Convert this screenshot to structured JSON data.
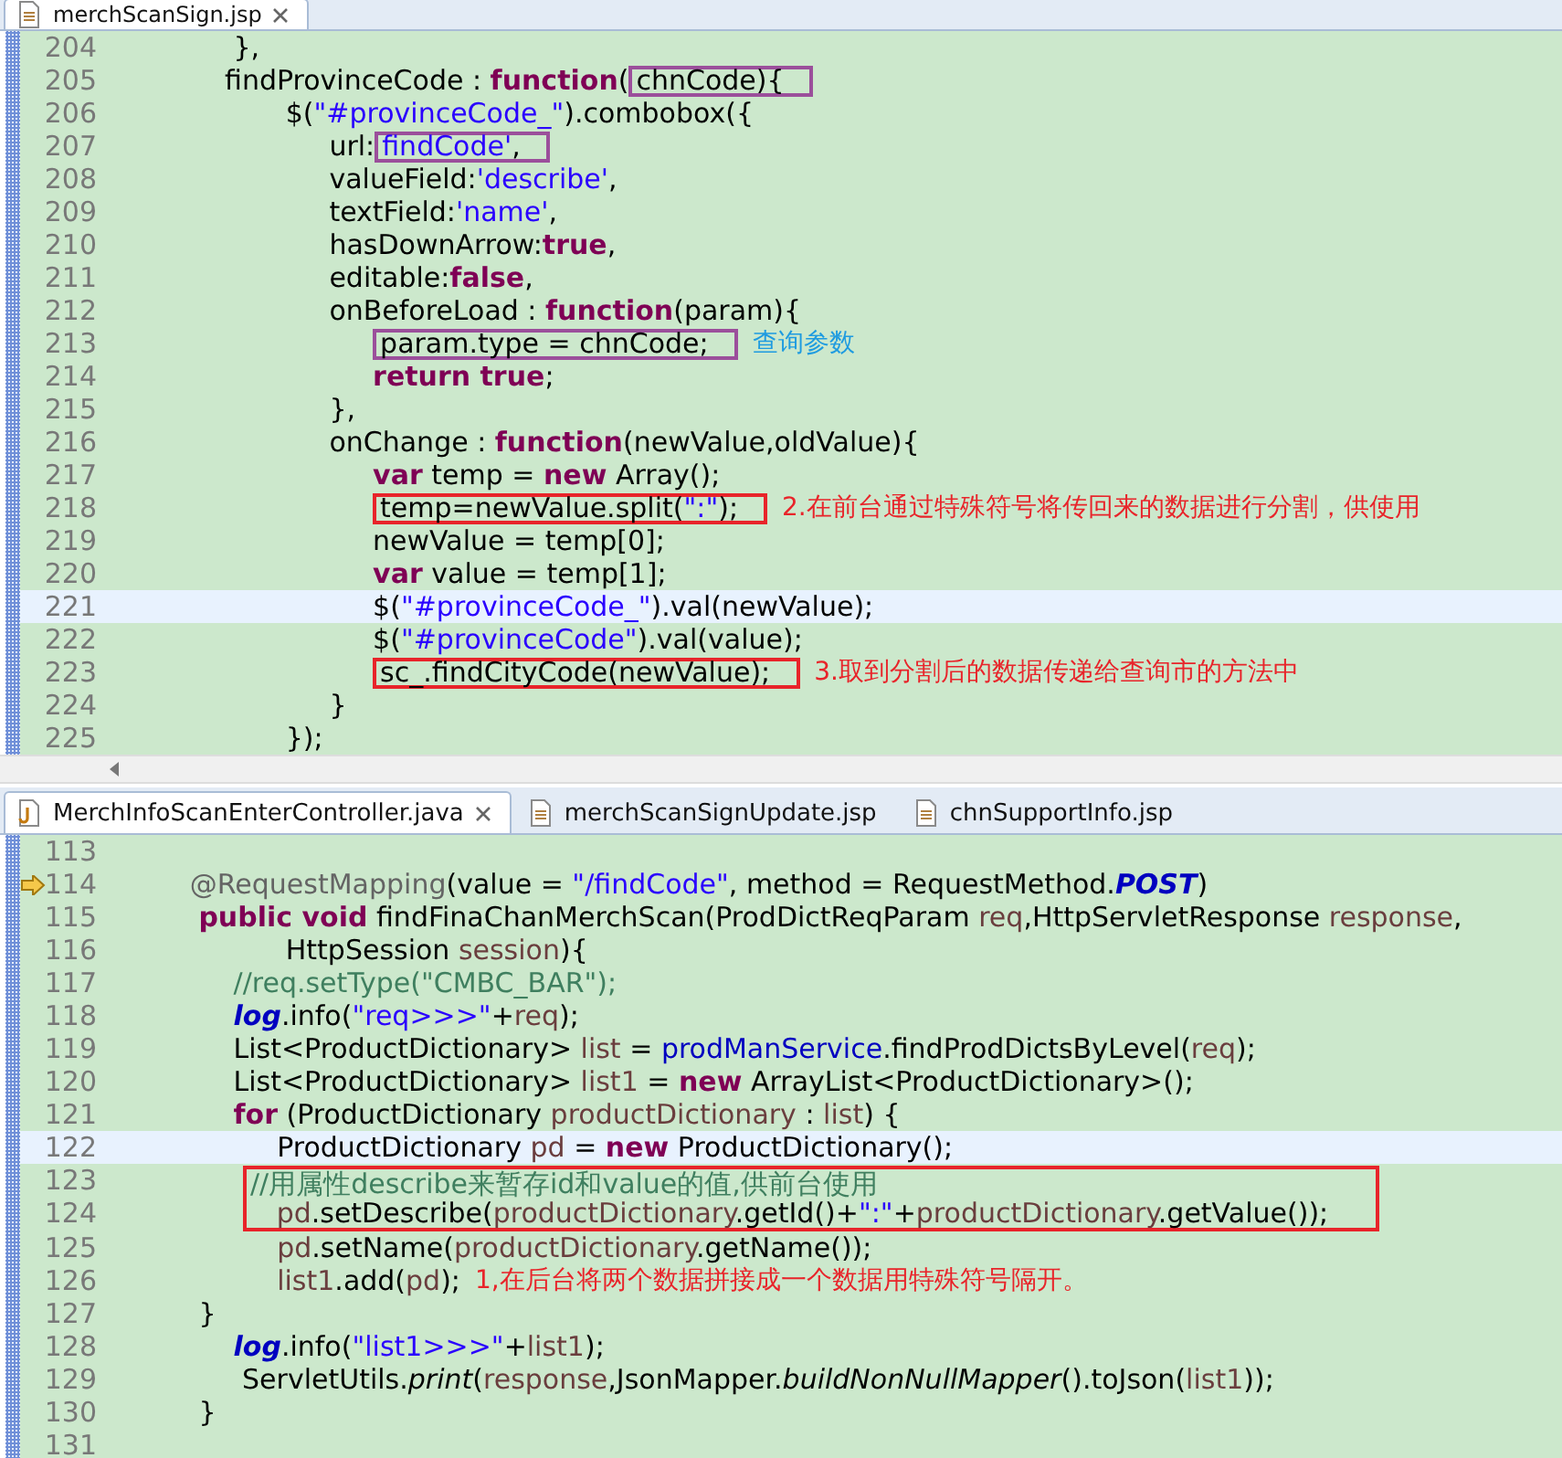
{
  "top_editor": {
    "tabs": [
      {
        "label": "merchScanSign.jsp",
        "selected": true,
        "closable": true
      }
    ],
    "lines": [
      {
        "kind": "line",
        "number": "204",
        "current": false,
        "tokens": [
          {
            "kind": "plain",
            "text": "              },"
          }
        ]
      },
      {
        "kind": "line",
        "number": "205",
        "current": false,
        "box": {
          "color": "#9b4f9b"
        },
        "tokens": [
          {
            "kind": "plain",
            "text": "             findProvinceCode : "
          },
          {
            "kind": "keyword",
            "text": "function"
          },
          {
            "kind": "plain",
            "text": "("
          },
          {
            "kind": "plain",
            "text": "chnCode){",
            "boxed": true
          }
        ]
      },
      {
        "kind": "line",
        "number": "206",
        "current": false,
        "tokens": [
          {
            "kind": "plain",
            "text": "                    $("
          },
          {
            "kind": "string",
            "text": "\"#provinceCode_\""
          },
          {
            "kind": "plain",
            "text": ").combobox({"
          }
        ]
      },
      {
        "kind": "line",
        "number": "207",
        "current": false,
        "box": {
          "color": "#9b4f9b"
        },
        "tokens": [
          {
            "kind": "plain",
            "text": "                         url:"
          },
          {
            "kind": "string",
            "text": "findCode'",
            "boxed": true
          },
          {
            "kind": "plain",
            "text": ",",
            "boxed": true
          }
        ]
      },
      {
        "kind": "line",
        "number": "208",
        "current": false,
        "tokens": [
          {
            "kind": "plain",
            "text": "                         valueField:"
          },
          {
            "kind": "string",
            "text": "'describe'"
          },
          {
            "kind": "plain",
            "text": ","
          }
        ]
      },
      {
        "kind": "line",
        "number": "209",
        "current": false,
        "tokens": [
          {
            "kind": "plain",
            "text": "                         textField:"
          },
          {
            "kind": "string",
            "text": "'name'"
          },
          {
            "kind": "plain",
            "text": ","
          }
        ]
      },
      {
        "kind": "line",
        "number": "210",
        "current": false,
        "tokens": [
          {
            "kind": "plain",
            "text": "                         hasDownArrow:"
          },
          {
            "kind": "keyword",
            "text": "true"
          },
          {
            "kind": "plain",
            "text": ","
          }
        ]
      },
      {
        "kind": "line",
        "number": "211",
        "current": false,
        "tokens": [
          {
            "kind": "plain",
            "text": "                         editable:"
          },
          {
            "kind": "keyword",
            "text": "false"
          },
          {
            "kind": "plain",
            "text": ","
          }
        ]
      },
      {
        "kind": "line",
        "number": "212",
        "current": false,
        "tokens": [
          {
            "kind": "plain",
            "text": "                         onBeforeLoad : "
          },
          {
            "kind": "keyword",
            "text": "function"
          },
          {
            "kind": "plain",
            "text": "(param){"
          }
        ]
      },
      {
        "kind": "line",
        "number": "213",
        "current": false,
        "box": {
          "color": "#9b4f9b"
        },
        "note": {
          "text": "查询参数",
          "color": "#1e9be0"
        },
        "tokens": [
          {
            "kind": "plain",
            "text": "                              param.type = chnCode;",
            "boxed": true
          }
        ]
      },
      {
        "kind": "line",
        "number": "214",
        "current": false,
        "tokens": [
          {
            "kind": "keyword",
            "text": "                              return true"
          },
          {
            "kind": "plain",
            "text": ";"
          }
        ]
      },
      {
        "kind": "line",
        "number": "215",
        "current": false,
        "tokens": [
          {
            "kind": "plain",
            "text": "                         },"
          }
        ]
      },
      {
        "kind": "line",
        "number": "216",
        "current": false,
        "tokens": [
          {
            "kind": "plain",
            "text": "                         onChange : "
          },
          {
            "kind": "keyword",
            "text": "function"
          },
          {
            "kind": "plain",
            "text": "(newValue,oldValue){"
          }
        ]
      },
      {
        "kind": "line",
        "number": "217",
        "current": false,
        "tokens": [
          {
            "kind": "keyword",
            "text": "                              var"
          },
          {
            "kind": "plain",
            "text": " temp = "
          },
          {
            "kind": "keyword",
            "text": "new"
          },
          {
            "kind": "plain",
            "text": " Array();"
          }
        ]
      },
      {
        "kind": "line",
        "number": "218",
        "current": false,
        "box": {
          "color": "#e8242a"
        },
        "note": {
          "text": "2.在前台通过特殊符号将传回来的数据进行分割，供使用",
          "color": "#e8242a"
        },
        "tokens": [
          {
            "kind": "plain",
            "text": "                              temp=newValue.split(",
            "boxed": true
          },
          {
            "kind": "string",
            "text": "\":\"",
            "boxed": true
          },
          {
            "kind": "plain",
            "text": ");",
            "boxed": true
          }
        ]
      },
      {
        "kind": "line",
        "number": "219",
        "current": false,
        "tokens": [
          {
            "kind": "plain",
            "text": "                              newValue = temp[0];"
          }
        ]
      },
      {
        "kind": "line",
        "number": "220",
        "current": false,
        "tokens": [
          {
            "kind": "keyword",
            "text": "                              var"
          },
          {
            "kind": "plain",
            "text": " value = temp[1];"
          }
        ]
      },
      {
        "kind": "line",
        "number": "221",
        "current": true,
        "tokens": [
          {
            "kind": "plain",
            "text": "                              $("
          },
          {
            "kind": "string",
            "text": "\"#provinceCode_\""
          },
          {
            "kind": "plain",
            "text": ").val(newValue);"
          }
        ]
      },
      {
        "kind": "line",
        "number": "222",
        "current": false,
        "tokens": [
          {
            "kind": "plain",
            "text": "                              $("
          },
          {
            "kind": "string",
            "text": "\"#provinceCode\""
          },
          {
            "kind": "plain",
            "text": ").val(value);"
          }
        ]
      },
      {
        "kind": "line",
        "number": "223",
        "current": false,
        "box": {
          "color": "#e8242a"
        },
        "note": {
          "text": "3.取到分割后的数据传递给查询市的方法中",
          "color": "#e8242a"
        },
        "tokens": [
          {
            "kind": "plain",
            "text": "                              sc_.findCityCode(newValue);",
            "boxed": true
          }
        ]
      },
      {
        "kind": "line",
        "number": "224",
        "current": false,
        "tokens": [
          {
            "kind": "plain",
            "text": "                         }"
          }
        ]
      },
      {
        "kind": "line",
        "number": "225",
        "current": false,
        "tokens": [
          {
            "kind": "plain",
            "text": "                    });"
          }
        ]
      }
    ]
  },
  "bottom_editor": {
    "tabs": [
      {
        "label": "MerchInfoScanEnterController.java",
        "selected": true,
        "closable": true,
        "kind": "java"
      },
      {
        "label": "merchScanSignUpdate.jsp",
        "selected": false,
        "closable": false,
        "kind": "jsp"
      },
      {
        "label": "chnSupportInfo.jsp",
        "selected": false,
        "closable": false,
        "kind": "jsp"
      }
    ],
    "lines": [
      {
        "kind": "line",
        "number": "113",
        "current": false
      },
      {
        "kind": "line",
        "number": "114",
        "current": false,
        "gutter_marker": {
          "kind": "arrow"
        },
        "tokens": [
          {
            "kind": "annotation",
            "text": "         @RequestMapping"
          },
          {
            "kind": "plain",
            "text": "(value = "
          },
          {
            "kind": "string",
            "text": "\"/findCode\""
          },
          {
            "kind": "plain",
            "text": ", method = RequestMethod."
          },
          {
            "kind": "static_field",
            "text": "POST"
          },
          {
            "kind": "plain",
            "text": ")"
          }
        ]
      },
      {
        "kind": "line",
        "number": "115",
        "current": false,
        "tokens": [
          {
            "kind": "keyword",
            "text": "          public void"
          },
          {
            "kind": "plain",
            "text": " findFinaChanMerchScan(ProdDictReqParam "
          },
          {
            "kind": "variable",
            "text": "req"
          },
          {
            "kind": "plain",
            "text": ",HttpServletResponse "
          },
          {
            "kind": "variable",
            "text": "response"
          },
          {
            "kind": "plain",
            "text": ","
          }
        ]
      },
      {
        "kind": "line",
        "number": "116",
        "current": false,
        "tokens": [
          {
            "kind": "plain",
            "text": "                    HttpSession "
          },
          {
            "kind": "variable",
            "text": "session"
          },
          {
            "kind": "plain",
            "text": "){"
          }
        ]
      },
      {
        "kind": "line",
        "number": "117",
        "current": false,
        "tokens": [
          {
            "kind": "comment",
            "text": "              //req.setType(\"CMBC_BAR\");"
          }
        ]
      },
      {
        "kind": "line",
        "number": "118",
        "current": false,
        "tokens": [
          {
            "kind": "static_field",
            "text": "              log"
          },
          {
            "kind": "plain",
            "text": ".info("
          },
          {
            "kind": "string",
            "text": "\"req>>>\""
          },
          {
            "kind": "plain",
            "text": "+"
          },
          {
            "kind": "variable",
            "text": "req"
          },
          {
            "kind": "plain",
            "text": ");"
          }
        ]
      },
      {
        "kind": "line",
        "number": "119",
        "current": false,
        "tokens": [
          {
            "kind": "plain",
            "text": "              List<ProductDictionary> "
          },
          {
            "kind": "variable",
            "text": "list"
          },
          {
            "kind": "plain",
            "text": " = "
          },
          {
            "kind": "member",
            "text": "prodManService"
          },
          {
            "kind": "plain",
            "text": ".findProdDictsByLevel("
          },
          {
            "kind": "variable",
            "text": "req"
          },
          {
            "kind": "plain",
            "text": ");"
          }
        ]
      },
      {
        "kind": "line",
        "number": "120",
        "current": false,
        "tokens": [
          {
            "kind": "plain",
            "text": "              List<ProductDictionary> "
          },
          {
            "kind": "variable",
            "text": "list1"
          },
          {
            "kind": "plain",
            "text": " = "
          },
          {
            "kind": "keyword",
            "text": "new"
          },
          {
            "kind": "plain",
            "text": " ArrayList<ProductDictionary>();"
          }
        ]
      },
      {
        "kind": "line",
        "number": "121",
        "current": false,
        "tokens": [
          {
            "kind": "keyword",
            "text": "              for"
          },
          {
            "kind": "plain",
            "text": " (ProductDictionary "
          },
          {
            "kind": "variable",
            "text": "productDictionary"
          },
          {
            "kind": "plain",
            "text": " : "
          },
          {
            "kind": "variable",
            "text": "list"
          },
          {
            "kind": "plain",
            "text": ") {"
          }
        ]
      },
      {
        "kind": "line",
        "number": "122",
        "current": true,
        "tokens": [
          {
            "kind": "plain",
            "text": "                   ProductDictionary "
          },
          {
            "kind": "variable",
            "text": "pd"
          },
          {
            "kind": "plain",
            "text": " = "
          },
          {
            "kind": "keyword",
            "text": "new"
          },
          {
            "kind": "plain",
            "text": " ProductDictionary();"
          }
        ]
      },
      {
        "kind": "group",
        "color": "#e8242a",
        "lines": [
          {
            "kind": "line",
            "number": "123",
            "current": false,
            "tokens": [
              {
                "kind": "comment",
                "text": "//用属性describe来暂存id和value的值,供前台使用"
              }
            ]
          },
          {
            "kind": "line",
            "number": "124",
            "current": false,
            "tokens": [
              {
                "kind": "variable",
                "text": "   pd"
              },
              {
                "kind": "plain",
                "text": ".setDescribe("
              },
              {
                "kind": "variable",
                "text": "productDictionary"
              },
              {
                "kind": "plain",
                "text": ".getId()+"
              },
              {
                "kind": "string",
                "text": "\":\""
              },
              {
                "kind": "plain",
                "text": "+"
              },
              {
                "kind": "variable",
                "text": "productDictionary"
              },
              {
                "kind": "plain",
                "text": ".getValue());"
              }
            ]
          }
        ]
      },
      {
        "kind": "line",
        "number": "125",
        "current": false,
        "tokens": [
          {
            "kind": "variable",
            "text": "                   pd"
          },
          {
            "kind": "plain",
            "text": ".setName("
          },
          {
            "kind": "variable",
            "text": "productDictionary"
          },
          {
            "kind": "plain",
            "text": ".getName());"
          }
        ]
      },
      {
        "kind": "line",
        "number": "126",
        "current": false,
        "note": {
          "text": "1,在后台将两个数据拼接成一个数据用特殊符号隔开。",
          "color": "#e8242a"
        },
        "tokens": [
          {
            "kind": "variable",
            "text": "                   list1"
          },
          {
            "kind": "plain",
            "text": ".add("
          },
          {
            "kind": "variable",
            "text": "pd"
          },
          {
            "kind": "plain",
            "text": ");"
          }
        ]
      },
      {
        "kind": "line",
        "number": "127",
        "current": false,
        "tokens": [
          {
            "kind": "plain",
            "text": "          }"
          }
        ]
      },
      {
        "kind": "line",
        "number": "128",
        "current": false,
        "tokens": [
          {
            "kind": "static_field",
            "text": "              log"
          },
          {
            "kind": "plain",
            "text": ".info("
          },
          {
            "kind": "string",
            "text": "\"list1>>>\""
          },
          {
            "kind": "plain",
            "text": "+"
          },
          {
            "kind": "variable",
            "text": "list1"
          },
          {
            "kind": "plain",
            "text": ");"
          }
        ]
      },
      {
        "kind": "line",
        "number": "129",
        "current": false,
        "tokens": [
          {
            "kind": "plain",
            "text": "               ServletUtils."
          },
          {
            "kind": "static_method",
            "text": "print"
          },
          {
            "kind": "plain",
            "text": "("
          },
          {
            "kind": "variable",
            "text": "response"
          },
          {
            "kind": "plain",
            "text": ",JsonMapper."
          },
          {
            "kind": "static_method",
            "text": "buildNonNullMapper"
          },
          {
            "kind": "plain",
            "text": "().toJson("
          },
          {
            "kind": "variable",
            "text": "list1"
          },
          {
            "kind": "plain",
            "text": "));"
          }
        ]
      },
      {
        "kind": "line",
        "number": "130",
        "current": false,
        "tokens": [
          {
            "kind": "plain",
            "text": "          }"
          }
        ]
      },
      {
        "kind": "line",
        "number": "131",
        "current": false
      }
    ]
  }
}
